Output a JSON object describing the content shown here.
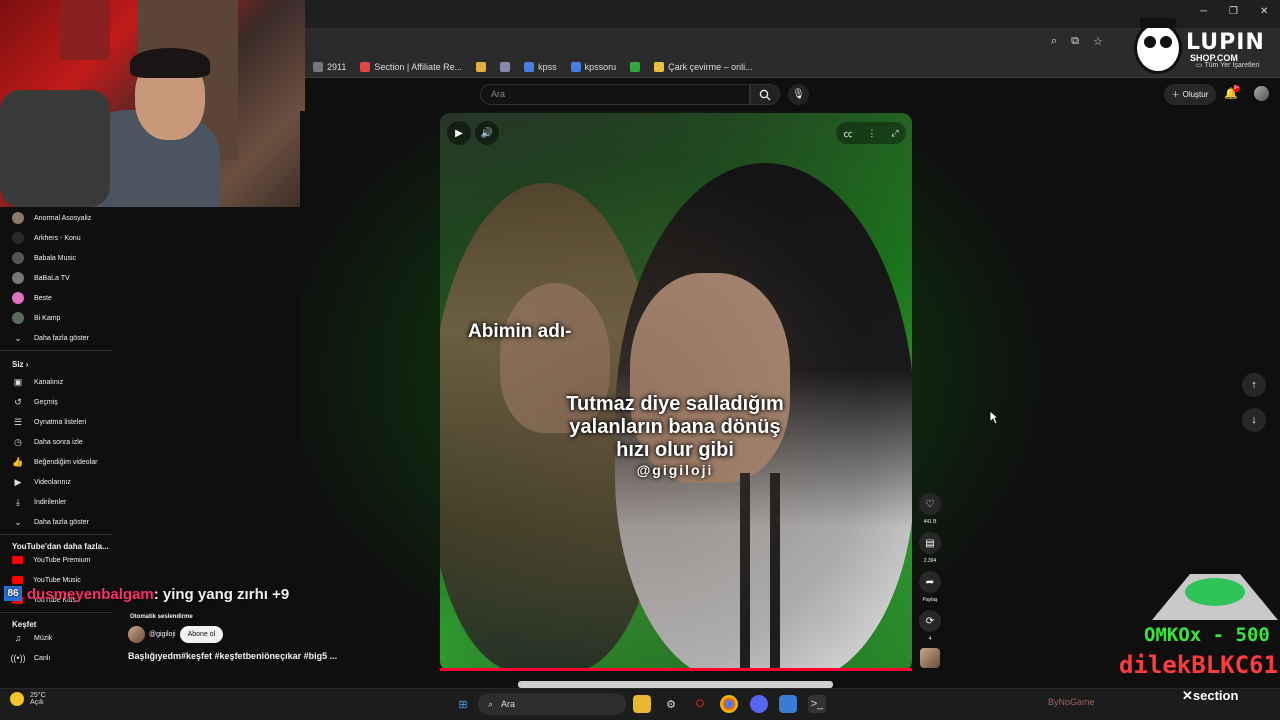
{
  "browser": {
    "bookmarks": [
      {
        "label": "2911",
        "color": "#777777"
      },
      {
        "label": "Section | Affiliate Re...",
        "color": "#e04646"
      },
      {
        "label": "",
        "color": "#e0b040"
      },
      {
        "label": "",
        "color": "#8888aa"
      },
      {
        "label": "kpss",
        "color": "#4a7be0"
      },
      {
        "label": "kpssoru",
        "color": "#4a7be0"
      },
      {
        "label": "",
        "color": "#2faa3a"
      },
      {
        "label": "Çark çevirme – onli...",
        "color": "#e8c040"
      }
    ],
    "all_bookmarks": "Tüm Yer İşaretleri",
    "window_controls": {
      "minimize": "─",
      "maximize": "❐",
      "close": "✕"
    }
  },
  "header": {
    "search_placeholder": "Ara",
    "create_label": "Oluştur",
    "notification_count": "9+"
  },
  "sidebar": {
    "subscriptions": [
      {
        "label": "Anormal Asosyaliz",
        "color": "#8a7a6a"
      },
      {
        "label": "Arkhers - Konu",
        "color": "#2a2a2a"
      },
      {
        "label": "Babala Music",
        "color": "#555555"
      },
      {
        "label": "BaBaLa TV",
        "color": "#777777"
      },
      {
        "label": "Beste",
        "color": "#e070c0"
      },
      {
        "label": "Bi Kamp",
        "color": "#5a6a5a"
      }
    ],
    "show_more_1": "Daha fazla göster",
    "you_heading": "Siz",
    "you_items": [
      {
        "label": "Kanalınız",
        "icon": "▣"
      },
      {
        "label": "Geçmiş",
        "icon": "↺"
      },
      {
        "label": "Oynatma listeleri",
        "icon": "☰"
      },
      {
        "label": "Daha sonra izle",
        "icon": "◷"
      },
      {
        "label": "Beğendiğim videolar",
        "icon": "👍"
      },
      {
        "label": "Videolarınız",
        "icon": "▶"
      },
      {
        "label": "İndirilenler",
        "icon": "⤓"
      }
    ],
    "show_more_2": "Daha fazla göster",
    "more_heading": "YouTube'dan daha fazla...",
    "more_items": [
      {
        "label": "YouTube Premium"
      },
      {
        "label": "YouTube Music"
      },
      {
        "label": "YouTube Kids"
      }
    ],
    "explore_heading": "Keşfet",
    "explore_items": [
      {
        "label": "Müzik",
        "icon": "♫"
      },
      {
        "label": "Canlı",
        "icon": "((•))"
      }
    ]
  },
  "video": {
    "caption_top": "Abimin adı-",
    "caption_line1": "Tutmaz diye salladığım",
    "caption_line2": "yalanların bana dönüş",
    "caption_line3": "hızı olur gibi",
    "watermark": "@gigiloji",
    "progress": 1.0
  },
  "actions": {
    "likes": "441 B",
    "comments": "2.394",
    "share": "Paylaş",
    "remix": "4"
  },
  "channel": {
    "autocaption": "Otomatik seslendirme",
    "name": "@gigiloji",
    "subscribe": "Abone ol",
    "hashtags": "Başlığıyedm#keşfet #keşfetbeniöneçıkar #big5 ..."
  },
  "overlay": {
    "chat_badge": "86",
    "chat_user": "dusmeyenbalgam",
    "chat_message": ": ying yang zırhı +9",
    "logo_main": "LUPIN",
    "logo_sub": "SHOP.COM",
    "donation_1": "OMKOx - 500",
    "donation_2": "dilekBLKC61",
    "section_brand": "section",
    "bynogame": "ByNoGame"
  },
  "taskbar": {
    "temperature": "25°C",
    "condition": "Açık",
    "search": "Ara"
  }
}
